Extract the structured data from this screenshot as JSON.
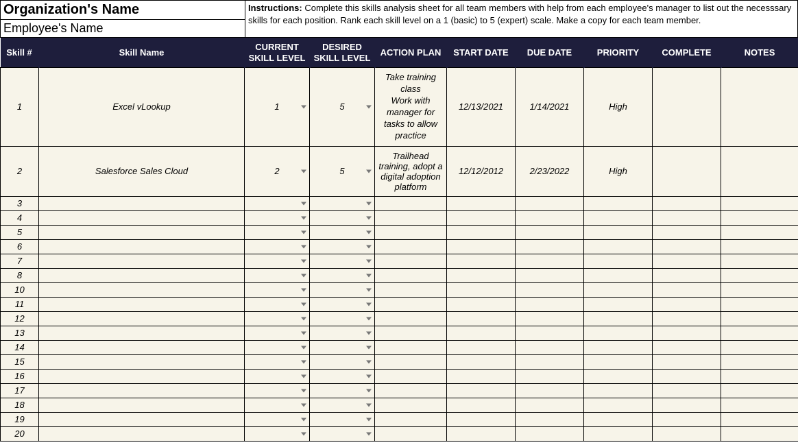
{
  "header": {
    "orgLabel": "Organization's Name",
    "empLabel": "Employee's Name",
    "instructionsLabel": "Instructions:",
    "instructionsText": " Complete this skills analysis sheet for all team members with help from each employee's manager to list out the necesssary skills for each position. Rank each skill level on a 1 (basic) to 5 (expert) scale. Make a copy for each team member."
  },
  "columns": {
    "num": "Skill #",
    "name": "Skill Name",
    "cur": "CURRENT SKILL LEVEL",
    "des": "DESIRED SKILL LEVEL",
    "plan": "ACTION PLAN",
    "start": "START DATE",
    "due": "DUE DATE",
    "prio": "PRIORITY",
    "comp": "COMPLETE",
    "notes": "NOTES"
  },
  "rows": [
    {
      "num": "1",
      "name": "Excel vLookup",
      "cur": "1",
      "des": "5",
      "plan": "Take training class\nWork with manager for tasks to allow practice",
      "start": "12/13/2021",
      "due": "1/14/2021",
      "prio": "High",
      "comp": "",
      "notes": "",
      "tall": true
    },
    {
      "num": "2",
      "name": "Salesforce Sales Cloud",
      "cur": "2",
      "des": "5",
      "plan": "Trailhead training, adopt a digital adoption platform",
      "start": "12/12/2012",
      "due": "2/23/2022",
      "prio": "High",
      "comp": "",
      "notes": "",
      "tall": true
    },
    {
      "num": "3",
      "name": "",
      "cur": "",
      "des": "",
      "plan": "",
      "start": "",
      "due": "",
      "prio": "",
      "comp": "",
      "notes": ""
    },
    {
      "num": "4",
      "name": "",
      "cur": "",
      "des": "",
      "plan": "",
      "start": "",
      "due": "",
      "prio": "",
      "comp": "",
      "notes": ""
    },
    {
      "num": "5",
      "name": "",
      "cur": "",
      "des": "",
      "plan": "",
      "start": "",
      "due": "",
      "prio": "",
      "comp": "",
      "notes": ""
    },
    {
      "num": "6",
      "name": "",
      "cur": "",
      "des": "",
      "plan": "",
      "start": "",
      "due": "",
      "prio": "",
      "comp": "",
      "notes": ""
    },
    {
      "num": "7",
      "name": "",
      "cur": "",
      "des": "",
      "plan": "",
      "start": "",
      "due": "",
      "prio": "",
      "comp": "",
      "notes": ""
    },
    {
      "num": "8",
      "name": "",
      "cur": "",
      "des": "",
      "plan": "",
      "start": "",
      "due": "",
      "prio": "",
      "comp": "",
      "notes": ""
    },
    {
      "num": "10",
      "name": "",
      "cur": "",
      "des": "",
      "plan": "",
      "start": "",
      "due": "",
      "prio": "",
      "comp": "",
      "notes": ""
    },
    {
      "num": "11",
      "name": "",
      "cur": "",
      "des": "",
      "plan": "",
      "start": "",
      "due": "",
      "prio": "",
      "comp": "",
      "notes": ""
    },
    {
      "num": "12",
      "name": "",
      "cur": "",
      "des": "",
      "plan": "",
      "start": "",
      "due": "",
      "prio": "",
      "comp": "",
      "notes": ""
    },
    {
      "num": "13",
      "name": "",
      "cur": "",
      "des": "",
      "plan": "",
      "start": "",
      "due": "",
      "prio": "",
      "comp": "",
      "notes": ""
    },
    {
      "num": "14",
      "name": "",
      "cur": "",
      "des": "",
      "plan": "",
      "start": "",
      "due": "",
      "prio": "",
      "comp": "",
      "notes": ""
    },
    {
      "num": "15",
      "name": "",
      "cur": "",
      "des": "",
      "plan": "",
      "start": "",
      "due": "",
      "prio": "",
      "comp": "",
      "notes": ""
    },
    {
      "num": "16",
      "name": "",
      "cur": "",
      "des": "",
      "plan": "",
      "start": "",
      "due": "",
      "prio": "",
      "comp": "",
      "notes": ""
    },
    {
      "num": "17",
      "name": "",
      "cur": "",
      "des": "",
      "plan": "",
      "start": "",
      "due": "",
      "prio": "",
      "comp": "",
      "notes": ""
    },
    {
      "num": "18",
      "name": "",
      "cur": "",
      "des": "",
      "plan": "",
      "start": "",
      "due": "",
      "prio": "",
      "comp": "",
      "notes": ""
    },
    {
      "num": "19",
      "name": "",
      "cur": "",
      "des": "",
      "plan": "",
      "start": "",
      "due": "",
      "prio": "",
      "comp": "",
      "notes": ""
    },
    {
      "num": "20",
      "name": "",
      "cur": "",
      "des": "",
      "plan": "",
      "start": "",
      "due": "",
      "prio": "",
      "comp": "",
      "notes": ""
    }
  ]
}
